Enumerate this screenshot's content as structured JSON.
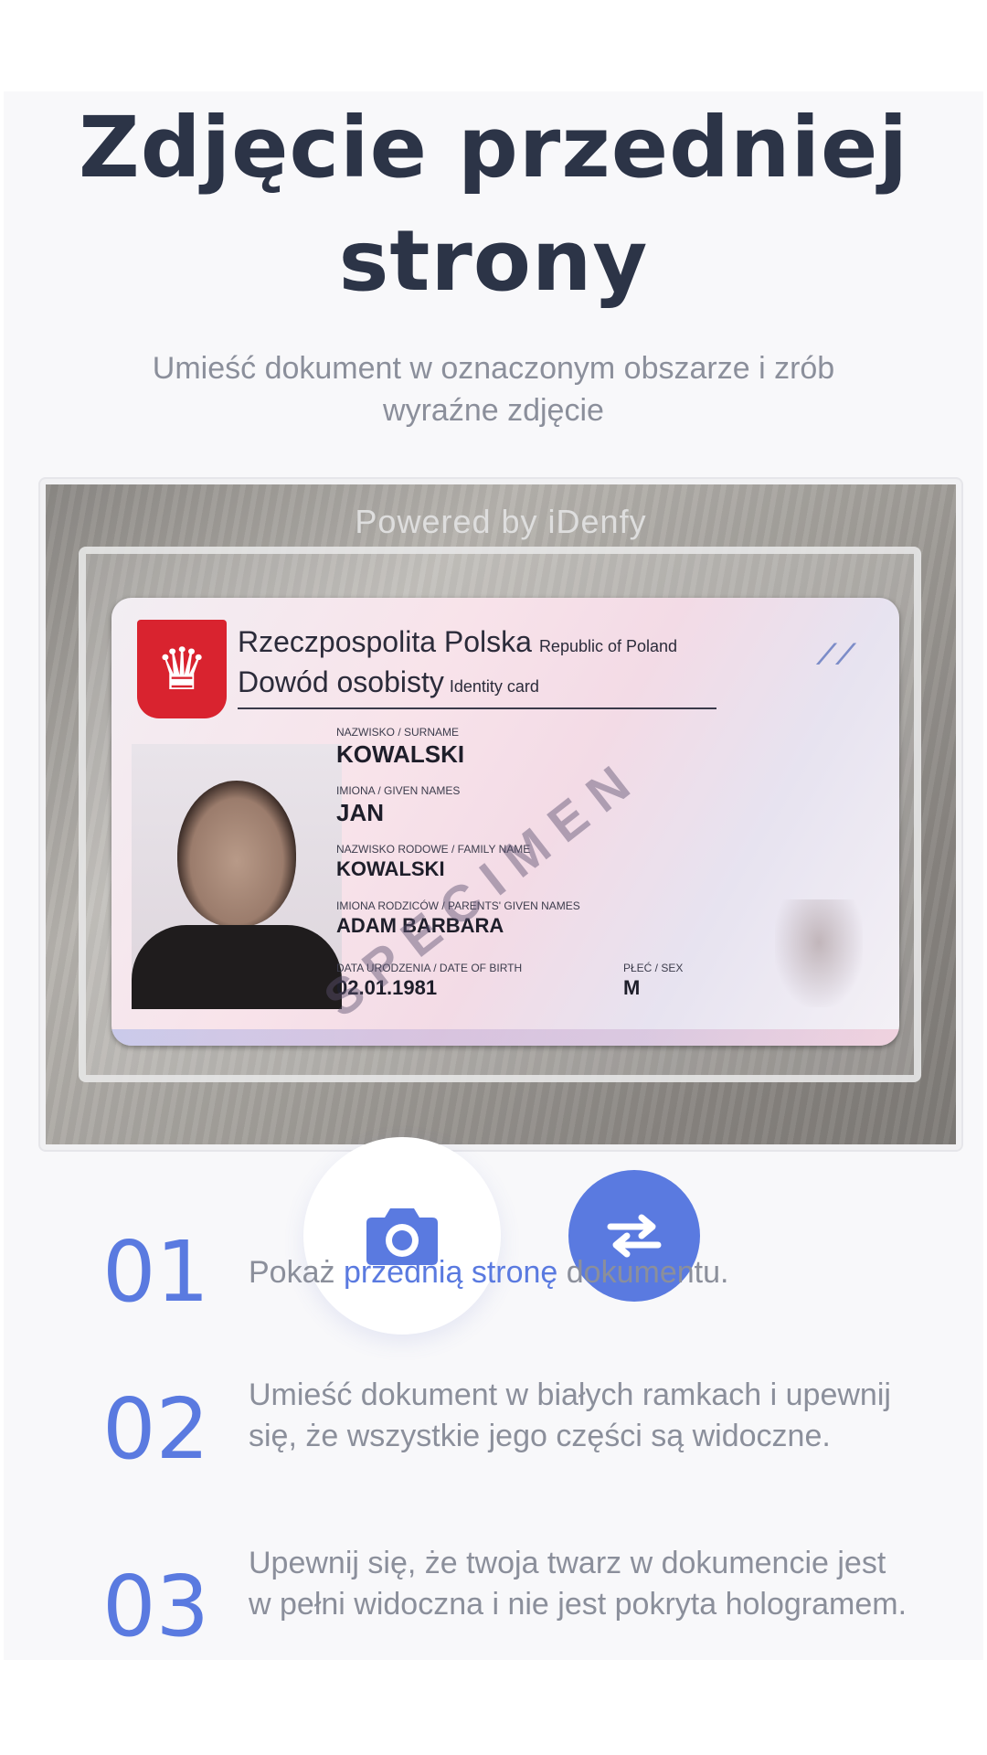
{
  "header": {
    "title": "Zdjęcie przedniej strony",
    "subtitle": "Umieść dokument w oznaczonym obszarze i zrób wyraźne zdjęcie"
  },
  "camera": {
    "powered_by": "Powered by iDenfy",
    "card": {
      "country": "Rzeczpospolita Polska",
      "country_en": "Republic of Poland",
      "doc_type": "Dowód osobisty",
      "doc_type_en": "Identity card",
      "surname_label": "NAZWISKO / SURNAME",
      "surname": "KOWALSKI",
      "given_label": "IMIONA / GIVEN NAMES",
      "given": "JAN",
      "family_label": "NAZWISKO RODOWE / FAMILY NAME",
      "family": "KOWALSKI",
      "parents_label": "IMIONA RODZICÓW / PARENTS' GIVEN NAMES",
      "parents": "ADAM BARBARA",
      "dob_label": "DATA URODZENIA / DATE OF BIRTH",
      "dob": "02.01.1981",
      "sex_label": "PŁEĆ / SEX",
      "sex": "M",
      "watermark": "SPECIMEN"
    },
    "shutter_icon": "camera-icon",
    "switch_icon": "swap-arrows-icon"
  },
  "steps": [
    {
      "number": "01",
      "text_before": "Pokaż ",
      "highlight": "przednią stronę",
      "text_after": " dokumentu."
    },
    {
      "number": "02",
      "text": "Umieść dokument w białych ramkach i upewnij się, że wszystkie jego części są widoczne."
    },
    {
      "number": "03",
      "text": "Upewnij się, że twoja twarz w dokumencie jest w pełni widoczna i nie jest pokryta hologramem."
    }
  ],
  "colors": {
    "accent": "#5a7ae0",
    "title": "#2c3447",
    "muted_text": "#8b8f9b",
    "background": "#f8f8fa"
  }
}
